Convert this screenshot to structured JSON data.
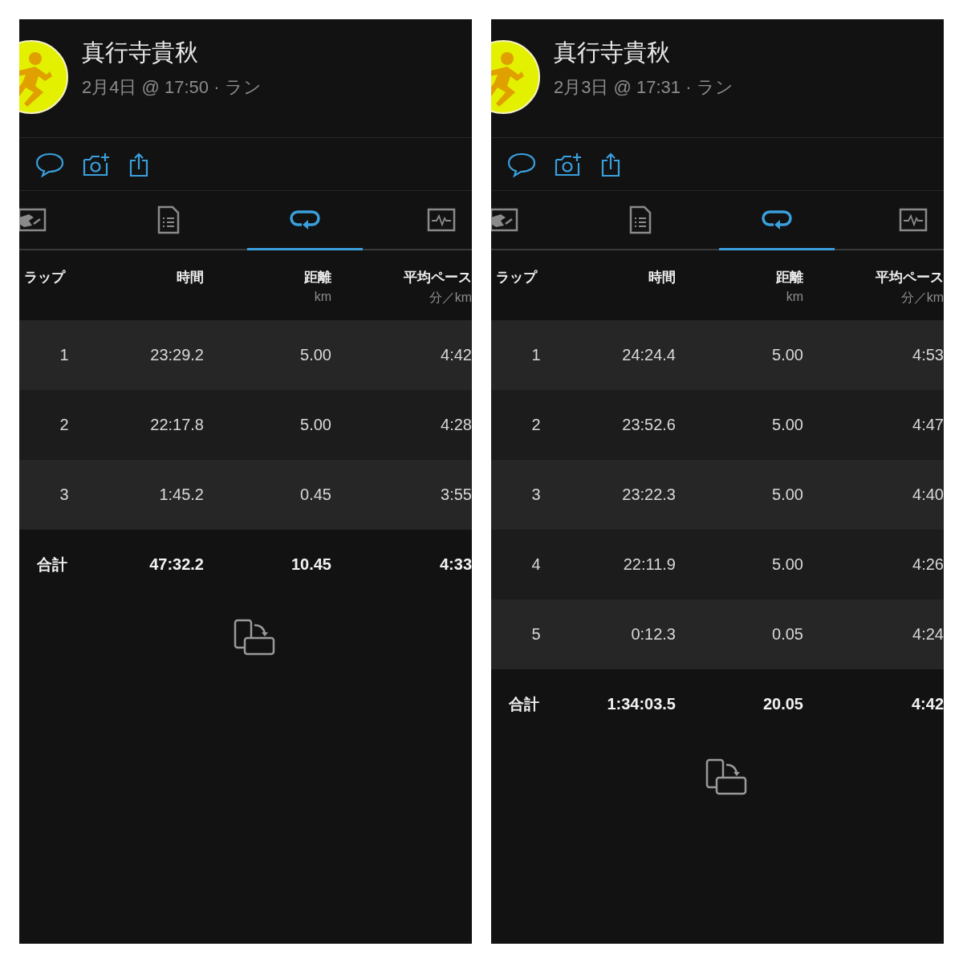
{
  "panels": [
    {
      "user": {
        "name": "真行寺貴秋",
        "subtitle": "2月4日 @ 17:50 · ラン"
      },
      "tabs": [
        {
          "kind": "activity",
          "selected": false
        },
        {
          "kind": "details",
          "selected": false
        },
        {
          "kind": "laps",
          "selected": true
        },
        {
          "kind": "chart",
          "selected": false
        }
      ],
      "columns": [
        {
          "label": "ラップ"
        },
        {
          "label": "時間"
        },
        {
          "label": "距離",
          "unit": "km"
        },
        {
          "label": "平均ペース",
          "unit": "分／km"
        }
      ],
      "rows": [
        {
          "lap": "1",
          "time": "23:29.2",
          "distance": "5.00",
          "pace": "4:42"
        },
        {
          "lap": "2",
          "time": "22:17.8",
          "distance": "5.00",
          "pace": "4:28"
        },
        {
          "lap": "3",
          "time": "1:45.2",
          "distance": "0.45",
          "pace": "3:55"
        }
      ],
      "total": {
        "label": "合計",
        "time": "47:32.2",
        "distance": "10.45",
        "pace": "4:33"
      }
    },
    {
      "user": {
        "name": "真行寺貴秋",
        "subtitle": "2月3日 @ 17:31 · ラン"
      },
      "tabs": [
        {
          "kind": "activity",
          "selected": false
        },
        {
          "kind": "details",
          "selected": false
        },
        {
          "kind": "laps",
          "selected": true
        },
        {
          "kind": "chart",
          "selected": false
        }
      ],
      "columns": [
        {
          "label": "ラップ"
        },
        {
          "label": "時間"
        },
        {
          "label": "距離",
          "unit": "km"
        },
        {
          "label": "平均ペース",
          "unit": "分／km"
        }
      ],
      "rows": [
        {
          "lap": "1",
          "time": "24:24.4",
          "distance": "5.00",
          "pace": "4:53"
        },
        {
          "lap": "2",
          "time": "23:52.6",
          "distance": "5.00",
          "pace": "4:47"
        },
        {
          "lap": "3",
          "time": "23:22.3",
          "distance": "5.00",
          "pace": "4:40"
        },
        {
          "lap": "4",
          "time": "22:11.9",
          "distance": "5.00",
          "pace": "4:26"
        },
        {
          "lap": "5",
          "time": "0:12.3",
          "distance": "0.05",
          "pace": "4:24"
        }
      ],
      "total": {
        "label": "合計",
        "time": "1:34:03.5",
        "distance": "20.05",
        "pace": "4:42"
      }
    }
  ]
}
